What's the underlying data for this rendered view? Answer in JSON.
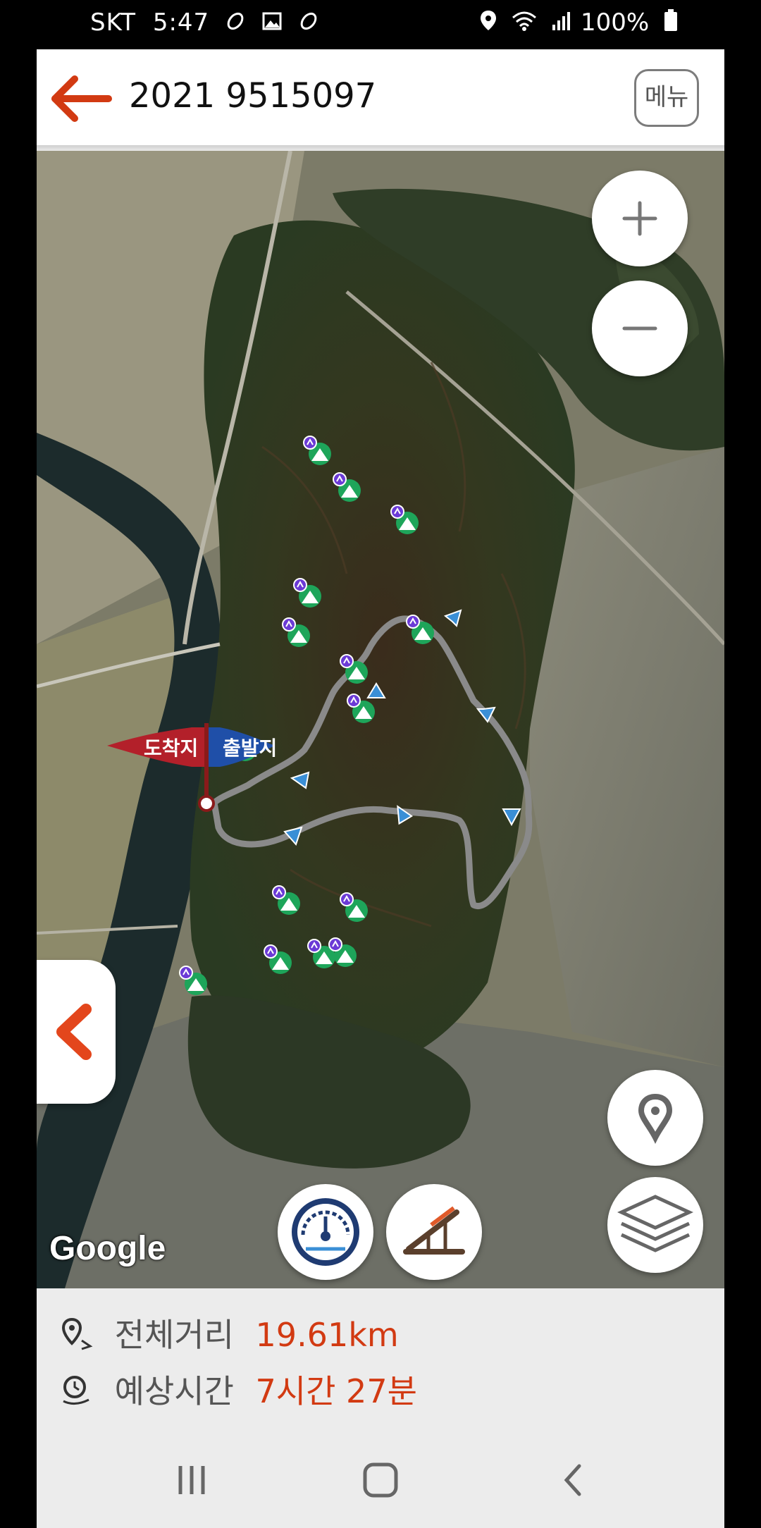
{
  "status_bar": {
    "carrier": "SKT",
    "time": "5:47",
    "battery": "100%"
  },
  "header": {
    "title": "2021 9515097",
    "menu_label": "메뉴"
  },
  "map": {
    "attribution": "Google",
    "start_label": "출발지",
    "end_label": "도착지",
    "route_color": "#8a8a8a",
    "accent_color": "#d23a12",
    "flag_start_color": "#1f4fa8",
    "flag_end_color": "#b3202a",
    "icons": [
      "zoom-in-icon",
      "zoom-out-icon",
      "location-pin-icon",
      "layers-icon",
      "speedometer-icon",
      "slope-icon",
      "chevron-left-icon",
      "peak-marker-icon"
    ]
  },
  "summary": {
    "distance_label": "전체거리",
    "distance_value": "19.61km",
    "time_label": "예상시간",
    "time_value": "7시간 27분"
  }
}
